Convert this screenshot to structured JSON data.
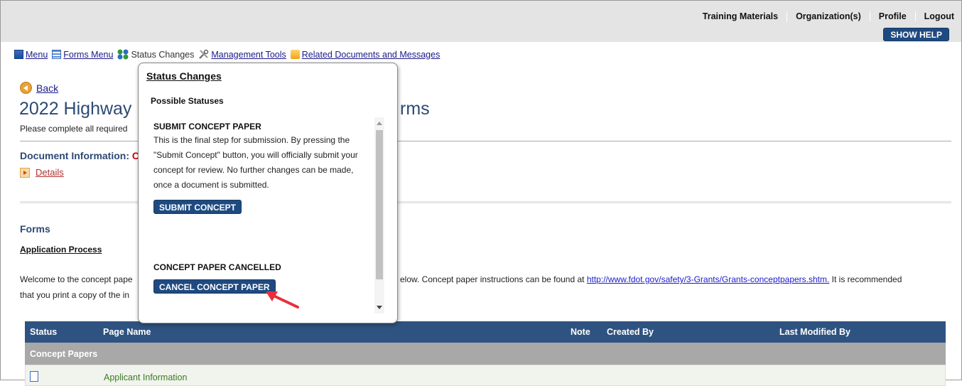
{
  "header": {
    "links": [
      "Training Materials",
      "Organization(s)",
      "Profile",
      "Logout"
    ],
    "show_help": "SHOW HELP"
  },
  "menubar": {
    "menu": "Menu",
    "forms_menu": "Forms Menu",
    "status_changes": "Status Changes",
    "management_tools": "Management Tools",
    "related_docs": "Related Documents and Messages"
  },
  "page": {
    "back": "Back",
    "title_left": "2022 Highway",
    "title_right": "rms",
    "instructions": "Please complete all required",
    "doc_info_label": "Document Information:",
    "doc_info_value": "C",
    "details": "Details",
    "forms_heading": "Forms",
    "application_process": "Application Process",
    "welcome_left": "Welcome to the concept pape",
    "welcome_right": "elow. Concept paper instructions can be found at ",
    "welcome_link": "http://www.fdot.gov/safety/3-Grants/Grants-conceptpapers.shtm.",
    "welcome_after": " It is recommended",
    "welcome_line2": "that you print a copy of the in"
  },
  "table": {
    "headers": {
      "status": "Status",
      "page_name": "Page Name",
      "note": "Note",
      "created_by": "Created By",
      "last_modified_by": "Last Modified By"
    },
    "group": "Concept Papers",
    "rows": [
      {
        "page_name": "Applicant Information"
      }
    ]
  },
  "popup": {
    "title": "Status Changes",
    "possible": "Possible Statuses",
    "submit_heading": "SUBMIT CONCEPT PAPER",
    "submit_desc": "This is the final step for submission. By pressing the \"Submit Concept\" button, you will officially submit your concept for review. No further changes can be made, once a document is submitted.",
    "submit_button": "SUBMIT CONCEPT",
    "cancel_heading": "CONCEPT PAPER CANCELLED",
    "cancel_button": "CANCEL CONCEPT PAPER"
  },
  "colors": {
    "nav_blue": "#1f4a80",
    "title_blue": "#2d4a74",
    "table_header": "#2f5381",
    "arrow_red": "#e8303a"
  }
}
